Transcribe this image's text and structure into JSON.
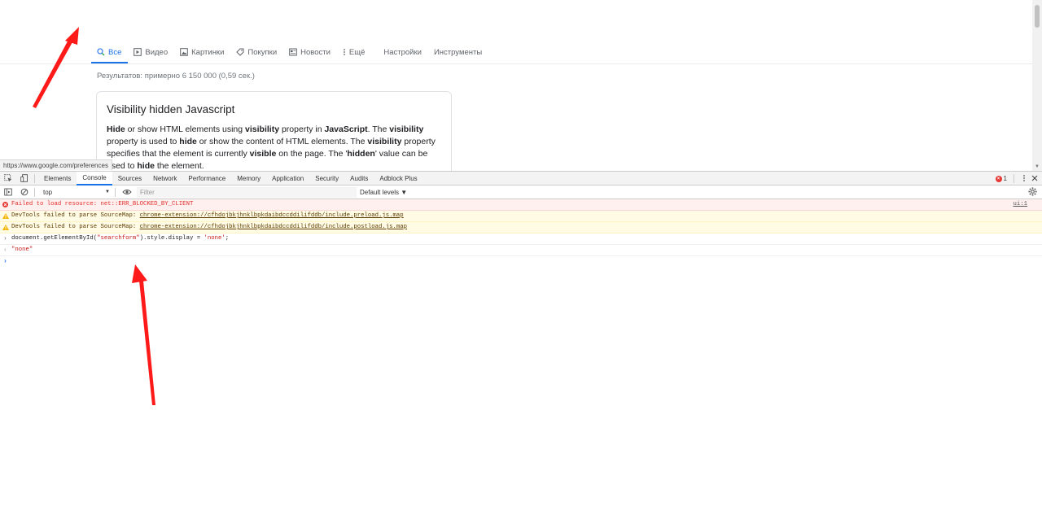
{
  "google": {
    "tabs": [
      {
        "label": "Все",
        "icon": "search-icon"
      },
      {
        "label": "Видео",
        "icon": "video-icon"
      },
      {
        "label": "Картинки",
        "icon": "image-icon"
      },
      {
        "label": "Покупки",
        "icon": "tag-icon"
      },
      {
        "label": "Новости",
        "icon": "newspaper-icon"
      },
      {
        "label": "Ещё",
        "icon": "more-vert-icon"
      },
      {
        "label": "Настройки"
      },
      {
        "label": "Инструменты"
      }
    ],
    "active_tab": "Все",
    "result_stats": "Результатов: примерно 6 150 000 (0,59 сек.)",
    "snippet": {
      "title": "Visibility hidden Javascript",
      "body_parts": [
        {
          "text": "Hide",
          "bold": true
        },
        {
          "text": " or show HTML elements using ",
          "bold": false
        },
        {
          "text": "visibility",
          "bold": true
        },
        {
          "text": " property in ",
          "bold": false
        },
        {
          "text": "JavaScript",
          "bold": true
        },
        {
          "text": ". The ",
          "bold": false
        },
        {
          "text": "visibility",
          "bold": true
        },
        {
          "text": " property is used to ",
          "bold": false
        },
        {
          "text": "hide",
          "bold": true
        },
        {
          "text": " or show the content of HTML elements. The ",
          "bold": false
        },
        {
          "text": "visibility",
          "bold": true
        },
        {
          "text": " property specifies that the element is currently ",
          "bold": false
        },
        {
          "text": "visible",
          "bold": true
        },
        {
          "text": " on the page. The '",
          "bold": false
        },
        {
          "text": "hidden",
          "bold": true
        },
        {
          "text": "' value can be used to ",
          "bold": false
        },
        {
          "text": "hide",
          "bold": true
        },
        {
          "text": " the element.",
          "bold": false
        }
      ]
    },
    "status_url": "https://www.google.com/preferences"
  },
  "devtools": {
    "tabs": [
      "Elements",
      "Console",
      "Sources",
      "Network",
      "Performance",
      "Memory",
      "Application",
      "Security",
      "Audits",
      "Adblock Plus"
    ],
    "active_tab": "Console",
    "error_count": "1",
    "context": "top",
    "filter_placeholder": "Filter",
    "levels_label": "Default levels ▼",
    "messages": [
      {
        "type": "error",
        "text": "Failed to load resource: net::ERR_BLOCKED_BY_CLIENT",
        "source": "ui:1"
      },
      {
        "type": "warn",
        "prefix": "DevTools failed to parse SourceMap: ",
        "link": "chrome-extension://cfhdojbkjhnklbpkdaibdccddilifddb/include.preload.js.map"
      },
      {
        "type": "warn",
        "prefix": "DevTools failed to parse SourceMap: ",
        "link": "chrome-extension://cfhdojbkjhnklbpkdaibdccddilifddb/include.postload.js.map"
      }
    ],
    "command": {
      "before": "document.getElementById(",
      "string": "\"searchform\"",
      "after": ").style.display = ",
      "value": "'none'",
      "end": ";"
    },
    "result": "\"none\"",
    "prompt_symbol": "›"
  },
  "colors": {
    "accent_blue": "#1a73e8",
    "error_red": "#e0302b",
    "arrow_red": "#ff1a1a"
  }
}
